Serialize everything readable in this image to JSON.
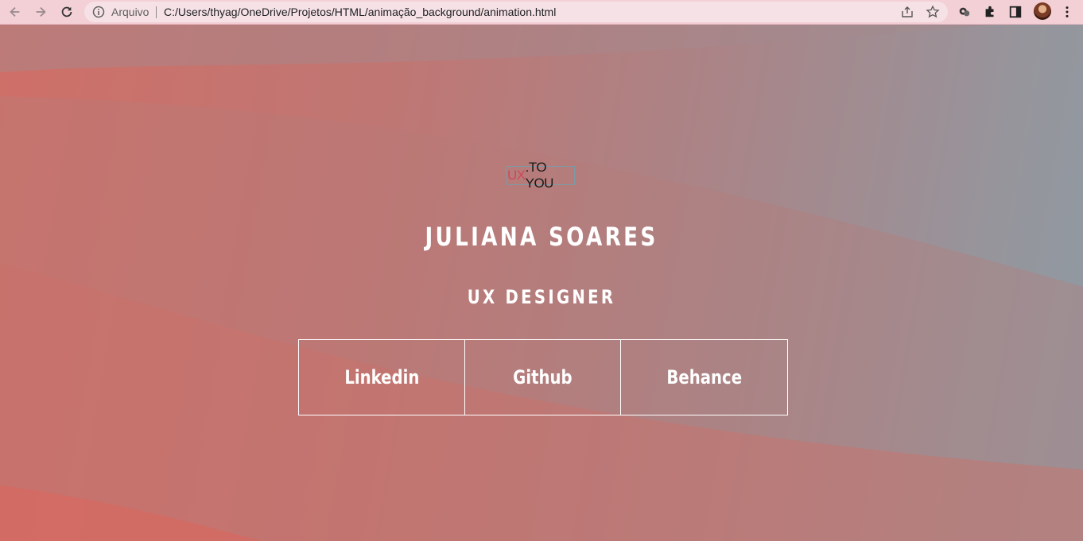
{
  "browser": {
    "security_label": "Arquivo",
    "url": "C:/Users/thyag/OneDrive/Projetos/HTML/animação_background/animation.html"
  },
  "logo": {
    "ux": "UX",
    "rest": ".TO YOU"
  },
  "hero": {
    "name": "JULIANA SOARES",
    "role": "UX DESIGNER"
  },
  "links": [
    {
      "label": "Linkedin"
    },
    {
      "label": "Github"
    },
    {
      "label": "Behance"
    }
  ],
  "colors": {
    "logo_accent": "#d0485a",
    "text": "#ffffff"
  }
}
